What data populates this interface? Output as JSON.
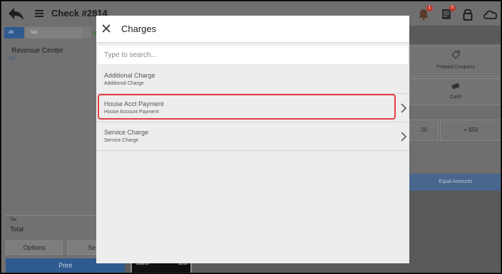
{
  "header": {
    "title": "Check #2814",
    "notifications_badge": "1",
    "orders_badge": "0"
  },
  "left_panel": {
    "tabs": [
      "All",
      "Tab"
    ],
    "add_label": "+",
    "revenue_center_label": "Revenue Center",
    "revenue_center_value": "Tab",
    "tax_label": "Tax",
    "total_label": "Total",
    "options_label": "Options",
    "second_button_label": "Se",
    "print_label": "Print"
  },
  "balance": {
    "label": "Balance",
    "value": "$0.00"
  },
  "right_panel": {
    "prepaid_coupons_label": "Prepaid Coupons",
    "cash_label": "Cash",
    "amount_left_label": "20",
    "amount_right_label": "+ $50",
    "equal_amounts_label": "Equal Amounts"
  },
  "modal": {
    "title": "Charges",
    "search_placeholder": "Type to search...",
    "items": [
      {
        "name": "Additional Charge",
        "subtitle": "Additional Charge",
        "has_chevron": false
      },
      {
        "name": "House Acct Payment",
        "subtitle": "House Account Payment",
        "has_chevron": true,
        "highlighted": true
      },
      {
        "name": "Service Charge",
        "subtitle": "Service Charge",
        "has_chevron": true
      }
    ]
  },
  "colors": {
    "accent_blue": "#2f5a90",
    "highlight_red": "#e53e46",
    "modal_bg": "#ededed",
    "overlay_gray": "#6f6f6f"
  },
  "icons": [
    "back-arrow-icon",
    "hamburger-menu-icon",
    "bell-icon",
    "receipt-icon",
    "lock-icon",
    "cloud-icon",
    "close-icon",
    "chevron-right-icon",
    "tag-icon",
    "cash-icon"
  ]
}
